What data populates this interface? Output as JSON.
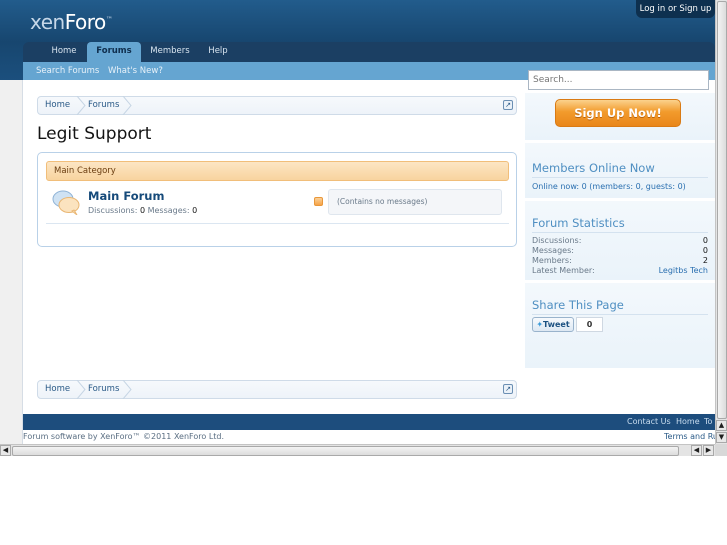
{
  "header": {
    "logo_main": "xen",
    "logo_accent": "Foro",
    "login_label": "Log in or Sign up"
  },
  "nav": {
    "tabs": [
      {
        "label": "Home",
        "selected": false
      },
      {
        "label": "Forums",
        "selected": true
      },
      {
        "label": "Members",
        "selected": false
      },
      {
        "label": "Help",
        "selected": false
      }
    ],
    "sub_links": [
      "Search Forums",
      "What's New?"
    ]
  },
  "breadcrumb": {
    "items": [
      "Home",
      "Forums"
    ]
  },
  "page": {
    "title": "Legit Support"
  },
  "category": {
    "name": "Main Category",
    "forums": [
      {
        "title": "Main Forum",
        "discussions_label": "Discussions:",
        "discussions": "0",
        "messages_label": "Messages:",
        "messages": "0",
        "last_post": "(Contains no messages)"
      }
    ]
  },
  "sidebar": {
    "search_placeholder": "Search...",
    "signup_label": "Sign Up Now!",
    "members_online": {
      "title": "Members Online Now",
      "summary": "Online now: 0 (members: 0, guests: 0)"
    },
    "forum_stats": {
      "title": "Forum Statistics",
      "rows": [
        {
          "label": "Discussions:",
          "value": "0"
        },
        {
          "label": "Messages:",
          "value": "0"
        },
        {
          "label": "Members:",
          "value": "2"
        },
        {
          "label": "Latest Member:",
          "value": "Legitbs Tech"
        }
      ]
    },
    "share": {
      "title": "Share This Page",
      "tweet_label": "Tweet",
      "tweet_count": "0"
    }
  },
  "footer": {
    "links": [
      "Contact Us",
      "Home",
      "To"
    ],
    "copyright": "Forum software by XenForo™ ©2011 XenForo Ltd.",
    "terms": "Terms and Ru"
  },
  "colors": {
    "header": "#1b4f7d",
    "nav_bar": "#1b3f63",
    "subnav": "#65a5d1",
    "category_bar": "#f8d49f",
    "signup_button": "#f29b2c",
    "sidebar_heading": "#4f8fc2",
    "footer_bar": "#1d4d7d"
  }
}
